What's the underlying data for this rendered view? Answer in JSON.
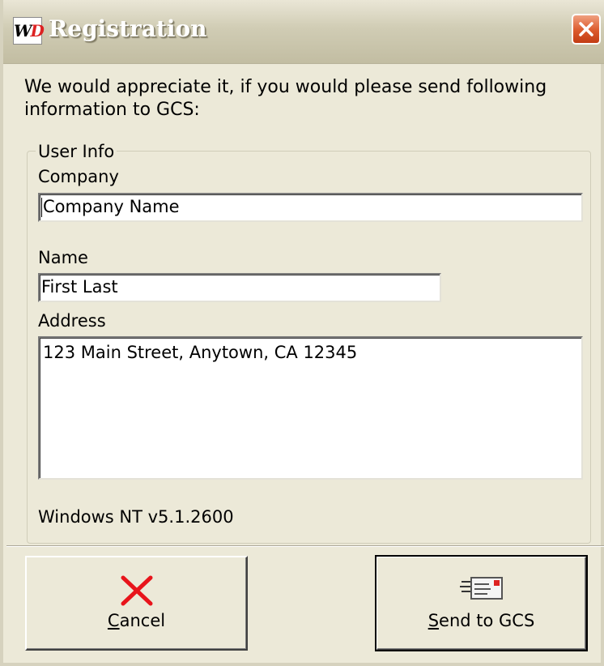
{
  "window": {
    "title": "Registration",
    "icon_name": "wd-app-icon",
    "close_icon": "close-icon"
  },
  "intro_text": "We would appreciate it, if you would please send following information to GCS:",
  "user_info": {
    "legend": "User Info",
    "company_label": "Company",
    "company_value": "Company Name",
    "name_label": "Name",
    "name_value": "First Last",
    "address_label": "Address",
    "address_value": "123 Main Street, Anytown, CA  12345"
  },
  "system_info": "Windows NT v5.1.2600",
  "buttons": {
    "cancel_mnemonic": "C",
    "cancel_rest": "ancel",
    "cancel_icon": "red-x-icon",
    "send_mnemonic": "S",
    "send_rest": "end to GCS",
    "send_icon": "envelope-icon"
  },
  "colors": {
    "window_bg": "#ECE9D8",
    "close_button": "#DC5A2C",
    "cancel_x": "#E8141B"
  }
}
